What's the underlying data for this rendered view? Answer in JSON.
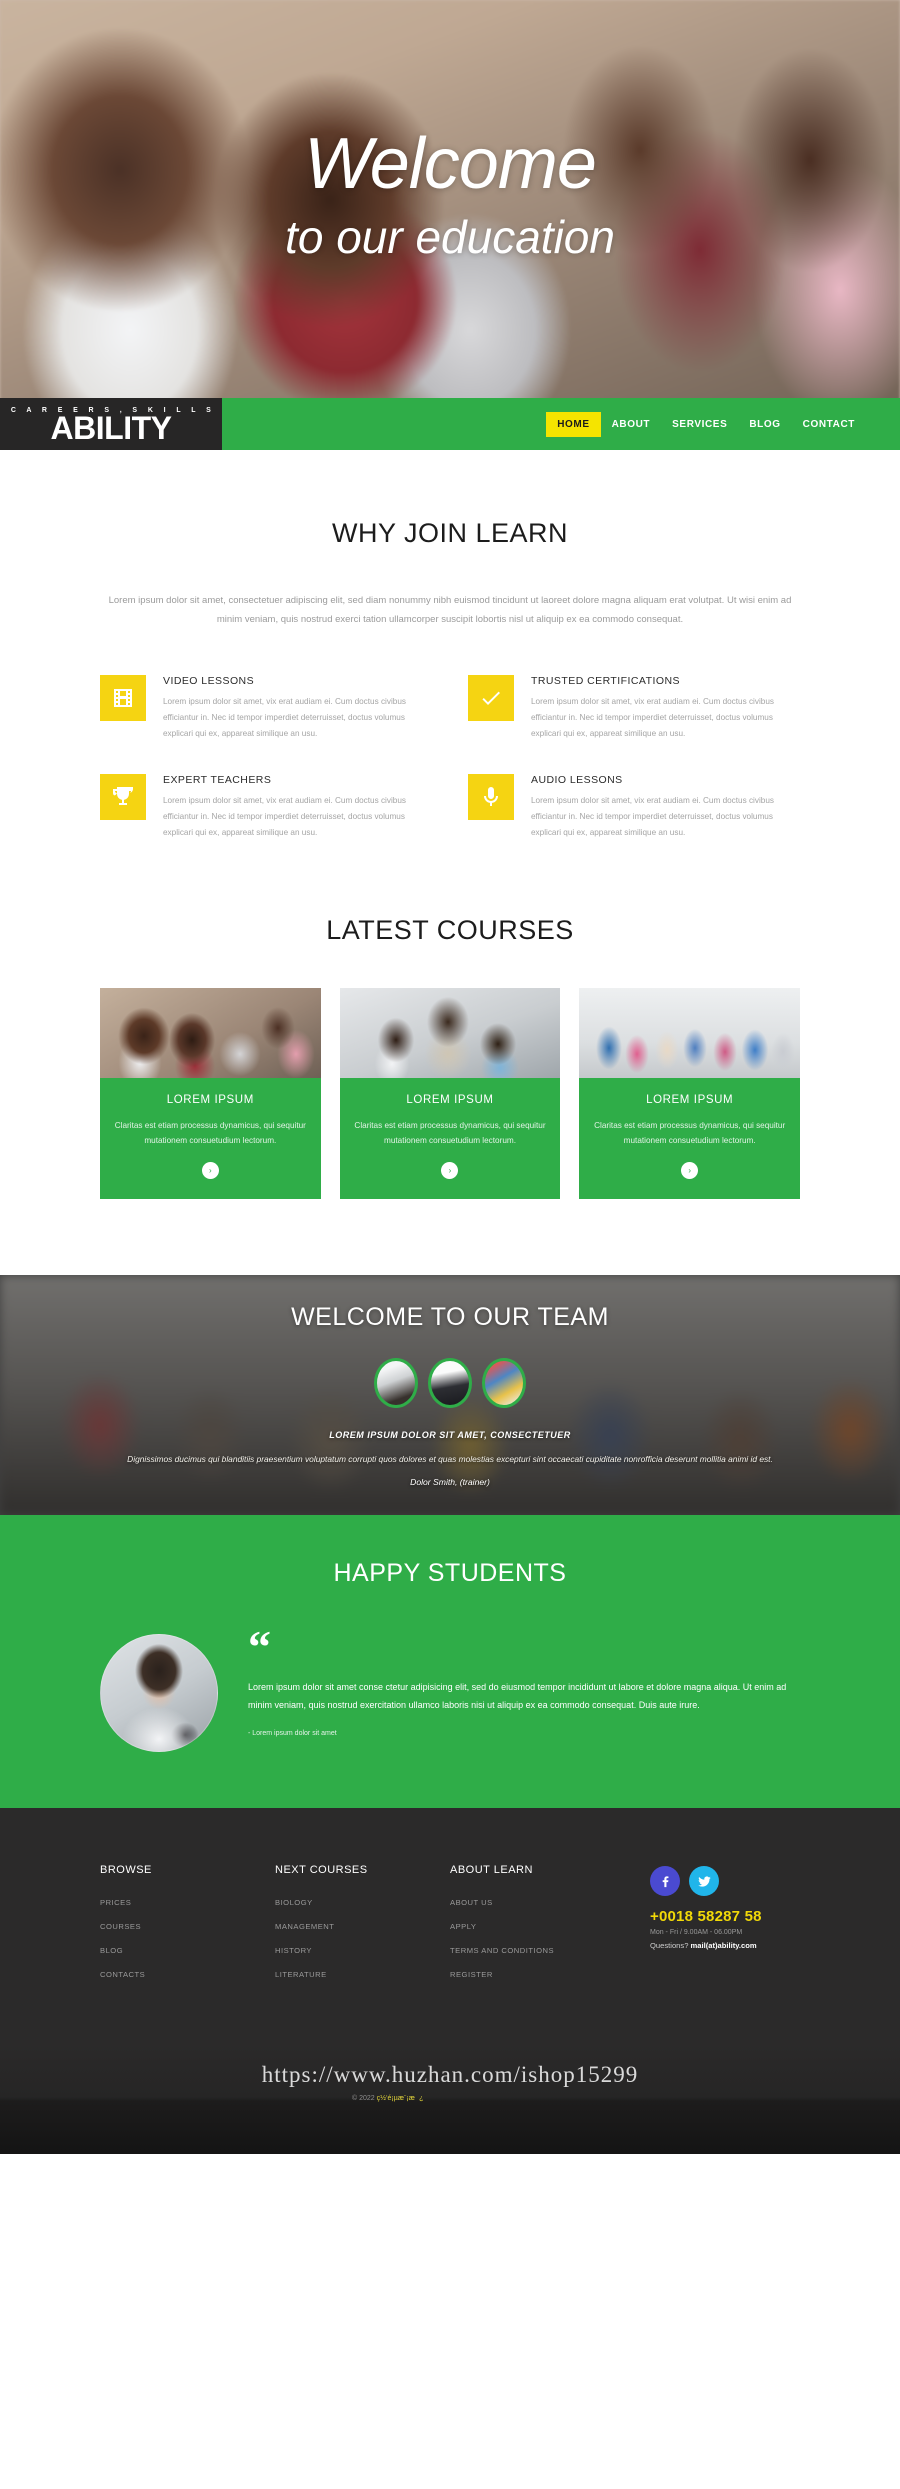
{
  "hero": {
    "title": "Welcome",
    "subtitle": "to our education"
  },
  "nav": {
    "logo_kicker": "C A R E E R S ,  S K I L L S",
    "logo_main": "ABILITY",
    "items": [
      {
        "label": "HOME",
        "active": true
      },
      {
        "label": "ABOUT",
        "active": false
      },
      {
        "label": "SERVICES",
        "active": false
      },
      {
        "label": "BLOG",
        "active": false
      },
      {
        "label": "CONTACT",
        "active": false
      }
    ]
  },
  "why": {
    "title": "WHY JOIN LEARN",
    "lead": "Lorem ipsum dolor sit amet, consectetuer adipiscing elit, sed diam nonummy nibh euismod tincidunt ut laoreet dolore magna aliquam erat volutpat. Ut wisi enim ad minim veniam, quis nostrud exerci tation ullamcorper suscipit lobortis nisl ut aliquip ex ea commodo consequat.",
    "features": [
      {
        "icon": "film-icon",
        "title": "VIDEO LESSONS",
        "text": "Lorem ipsum dolor sit amet, vix erat audiam ei. Cum doctus civibus efficiantur in. Nec id tempor imperdiet deterruisset, doctus volumus explicari qui ex, appareat similique an usu."
      },
      {
        "icon": "check-icon",
        "title": "TRUSTED CERTIFICATIONS",
        "text": "Lorem ipsum dolor sit amet, vix erat audiam ei. Cum doctus civibus efficiantur in. Nec id tempor imperdiet deterruisset, doctus volumus explicari qui ex, appareat similique an usu."
      },
      {
        "icon": "trophy-icon",
        "title": "EXPERT TEACHERS",
        "text": "Lorem ipsum dolor sit amet, vix erat audiam ei. Cum doctus civibus efficiantur in. Nec id tempor imperdiet deterruisset, doctus volumus explicari qui ex, appareat similique an usu."
      },
      {
        "icon": "microphone-icon",
        "title": "AUDIO LESSONS",
        "text": "Lorem ipsum dolor sit amet, vix erat audiam ei. Cum doctus civibus efficiantur in. Nec id tempor imperdiet deterruisset, doctus volumus explicari qui ex, appareat similique an usu."
      }
    ]
  },
  "courses": {
    "title": "LATEST COURSES",
    "cards": [
      {
        "title": "LOREM IPSUM",
        "text": "Claritas est etiam processus dynamicus, qui sequitur mutationem consuetudium lectorum.",
        "arrow": "›"
      },
      {
        "title": "LOREM IPSUM",
        "text": "Claritas est etiam processus dynamicus, qui sequitur mutationem consuetudium lectorum.",
        "arrow": "›"
      },
      {
        "title": "LOREM IPSUM",
        "text": "Claritas est etiam processus dynamicus, qui sequitur mutationem consuetudium lectorum.",
        "arrow": "›"
      }
    ]
  },
  "team": {
    "title": "WELCOME TO OUR TEAM",
    "kicker": "LOREM IPSUM DOLOR SIT AMET, CONSECTETUER",
    "quote": "Dignissimos ducimus qui blanditiis praesentium voluptatum corrupti quos dolores et quas molestias excepturi sint occaecati cupiditate nonrofficia deserunt mollitia animi id est.",
    "author": "Dolor Smith, (trainer)"
  },
  "happy": {
    "title": "HAPPY STUDENTS",
    "quote_mark": "“",
    "text": "Lorem ipsum dolor sit amet conse ctetur adipisicing elit, sed do eiusmod tempor incididunt ut labore et dolore magna aliqua. Ut enim ad minim veniam, quis nostrud exercitation ullamco laboris nisi ut aliquip ex ea commodo consequat. Duis aute irure.",
    "cite": "-   Lorem ipsum dolor sit amet"
  },
  "footer": {
    "columns": [
      {
        "heading": "BROWSE",
        "links": [
          "PRICES",
          "COURSES",
          "BLOG",
          "CONTACTS"
        ]
      },
      {
        "heading": "NEXT COURSES",
        "links": [
          "BIOLOGY",
          "MANAGEMENT",
          "HISTORY",
          "LITERATURE"
        ]
      },
      {
        "heading": "ABOUT LEARN",
        "links": [
          "ABOUT US",
          "APPLY",
          "TERMS AND CONDITIONS",
          "REGISTER"
        ]
      }
    ],
    "social": [
      {
        "name": "facebook-icon",
        "color": "#4a4ad1"
      },
      {
        "name": "twitter-icon",
        "color": "#20b5ea"
      }
    ],
    "phone": "+0018 58287 58",
    "hours": "Mon - Fri / 9.00AM - 06.00PM",
    "mail_prefix": "Questions? ",
    "mail": "mail(at)ability.com",
    "watermark": "https://www.huzhan.com/ishop15299",
    "copyright_prefix": "© 2022 ",
    "copyright_name": "ç½‘é¡µæ¨¡æ¿"
  },
  "colors": {
    "green": "#2fad48",
    "yellow": "#f5d412",
    "nav_active": "#f5e400",
    "dark": "#2b2a2a"
  }
}
